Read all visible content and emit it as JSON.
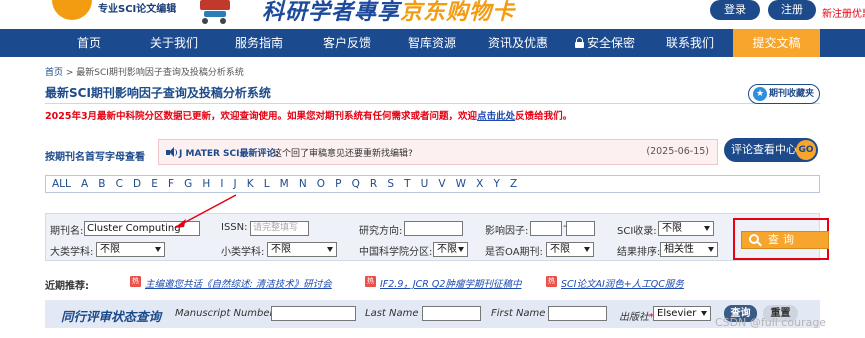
{
  "header": {
    "logo_tagline": "专业SCI论文编辑",
    "slogan_part1": "科研学者專享",
    "slogan_part2": "京东购物卡",
    "login_label": "登录",
    "register_label": "注册",
    "new_register_promo": "新注册优惠"
  },
  "nav": {
    "items": [
      {
        "label": "首页"
      },
      {
        "label": "关于我们"
      },
      {
        "label": "服务指南"
      },
      {
        "label": "客户反馈"
      },
      {
        "label": "智库资源"
      },
      {
        "label": "资讯及优惠"
      },
      {
        "label": "安全保密"
      },
      {
        "label": "联系我们"
      },
      {
        "label": "提交文稿"
      }
    ],
    "active_color": "#f7a52c",
    "bar_color": "#1c4a8f"
  },
  "breadcrumb": {
    "home": "首页",
    "separator": " > ",
    "current": "最新SCI期刊影响因子查询及投稿分析系统"
  },
  "page_title": "最新SCI期刊影响因子查询及投稿分析系统",
  "favorite_button": "期刊收藏夹",
  "notice": {
    "text_before": "2025年3月最新中科院分区数据已更新，欢迎查询使用。如果您对期刊系统有任何需求或者问题，欢迎",
    "link": "点击此处",
    "text_after": "反馈给我们。"
  },
  "browse": {
    "label": "按期刊名首写字母查看",
    "letters": [
      "ALL",
      "A",
      "B",
      "C",
      "D",
      "E",
      "F",
      "G",
      "H",
      "I",
      "J",
      "K",
      "L",
      "M",
      "N",
      "O",
      "P",
      "Q",
      "R",
      "S",
      "T",
      "U",
      "V",
      "W",
      "X",
      "Y",
      "Z"
    ]
  },
  "review": {
    "source": "J MATER SCI最新评论:",
    "text": "这个回了审稿意见还要重新找编辑?",
    "date": "(2025-06-15)",
    "center_label": "评论查看中心",
    "go_label": "GO"
  },
  "search": {
    "journal_label": "期刊名:",
    "journal_value": "Cluster Computing",
    "issn_label": "ISSN:",
    "issn_placeholder": "请完整填写",
    "research_label": "研究方向:",
    "research_value": "",
    "if_label": "影响因子:",
    "if_min": "",
    "if_sep": "-",
    "if_max": "",
    "sci_label": "SCI收录:",
    "sci_value": "不限",
    "major_label": "大类学科:",
    "major_value": "不限",
    "minor_label": "小类学科:",
    "minor_value": "不限",
    "cas_label": "中国科学院分区:",
    "cas_value": "不限",
    "oa_label": "是否OA期刊:",
    "oa_value": "不限",
    "sort_label": "结果排序:",
    "sort_value": "相关性",
    "query_label": "查询"
  },
  "recommend": {
    "label": "近期推荐:",
    "hot_tag": "热",
    "links": [
      "主编邀您共话《自然综述: 清洁技术》研讨会",
      "IF2.9，JCR Q2肿瘤学期刊征稿中",
      "SCI论文AI润色+人工QC服务"
    ]
  },
  "peer_review": {
    "title": "同行评审状态查询",
    "manuscript_label": "Manuscript Number",
    "lastname_label": "Last Name",
    "firstname_label": "First Name",
    "publisher_label": "出版社",
    "required_mark": "*",
    "publisher_value": "Elsevier",
    "query_button": "查询",
    "reset_button": "重置"
  },
  "watermark": "CSDN @full courage"
}
